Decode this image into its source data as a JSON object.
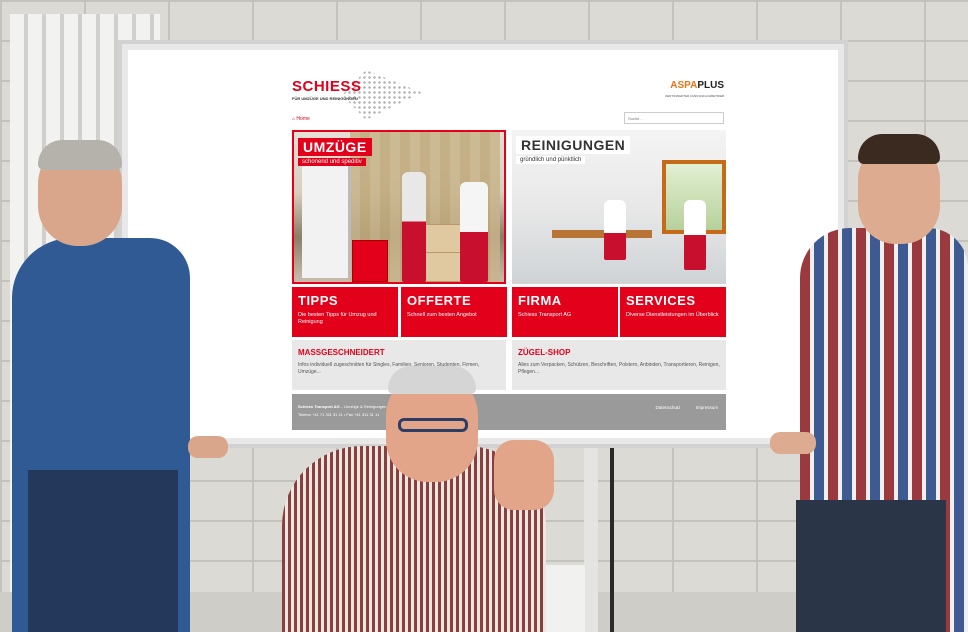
{
  "scene": {
    "description_colors": {
      "brand_red": "#e2001a",
      "wall": "#dcdad5"
    }
  },
  "website": {
    "logo": "SCHIESS",
    "logo_sub": "FÜR UMZÜGE UND REINIGUNGEN",
    "partner_logo": "ASPA",
    "partner_logo_plus": "PLUS",
    "partner_sub": "ZERTIFIZIERTER UMZUGSFACHBETRIEB",
    "home_link": "Home",
    "search_placeholder": "Suche...",
    "hero_left": {
      "title": "UMZÜGE",
      "subtitle": "schonend und speditiv"
    },
    "hero_right": {
      "title": "REINIGUNGEN",
      "subtitle": "gründlich und pünktlich"
    },
    "tiles": [
      {
        "title": "TIPPS",
        "text": "Die besten Tipps für Umzug und Reinigung"
      },
      {
        "title": "OFFERTE",
        "text": "Schnell zum besten Angebot"
      },
      {
        "title": "FIRMA",
        "text": "Schiess Transport AG"
      },
      {
        "title": "SERVICES",
        "text": "Diverse Dienstleistungen im Überblick"
      }
    ],
    "info_left": {
      "title": "MASSGESCHNEIDERT",
      "text": "Infos individuell zugeschnitten für Singles, Familien, Senioren, Studenten, Firmen, Umzüge..."
    },
    "info_right": {
      "title": "ZÜGEL-SHOP",
      "text": "Alles zum Verpacken, Schützen, Beschriften, Polstern, Anbinden, Transportieren, Reinigen, Pflegen..."
    },
    "footer": {
      "company": "Schiess Transport AG",
      "address": " – Umzüge & Reinigungen – 8360 Altnau",
      "contact": "Telefon +41 71 311 31 11 • Fax +41 311 31 11",
      "link_privacy": "Datenschutz",
      "link_imprint": "Impressum"
    }
  }
}
